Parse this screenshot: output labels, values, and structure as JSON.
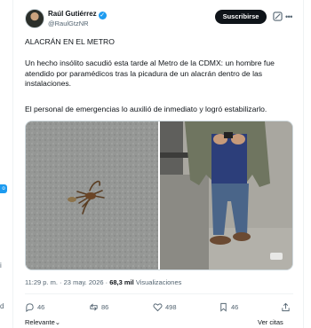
{
  "author": {
    "name": "Raúl Gutiérrez",
    "handle": "@RaulGtzNR",
    "verified_glyph": "✓"
  },
  "subscribe_label": "Suscribirse",
  "tweet": {
    "title": "ALACRÁN EN EL METRO",
    "paragraph1": "Un hecho insólito sacudió esta tarde al Metro de la CDMX: un hombre fue atendido por paramédicos tras la picadura de un alacrán dentro de las instalaciones.",
    "paragraph2": "El personal de emergencias lo auxilió de inmediato y logró estabilizarlo."
  },
  "meta": {
    "time": "11:29 p. m.",
    "separator": " · ",
    "date": "23 may. 2026",
    "views_count": "68,3 mil",
    "views_label": "Visualizaciones"
  },
  "actions": {
    "replies": "46",
    "reposts": "86",
    "likes": "498",
    "bookmarks": "46"
  },
  "footer": {
    "relevant_label": "Relevante",
    "quotes_label": "Ver citas"
  },
  "left_edge": {
    "badge": "o",
    "text_a": "i",
    "text_b": "d"
  },
  "colors": {
    "accent": "#1d9bf0",
    "text": "#0f1419",
    "muted": "#536471"
  },
  "icons": [
    "verified-icon",
    "grok-icon",
    "more-icon",
    "reply-icon",
    "repost-icon",
    "like-icon",
    "bookmark-icon",
    "share-icon",
    "chevron-down-icon"
  ]
}
